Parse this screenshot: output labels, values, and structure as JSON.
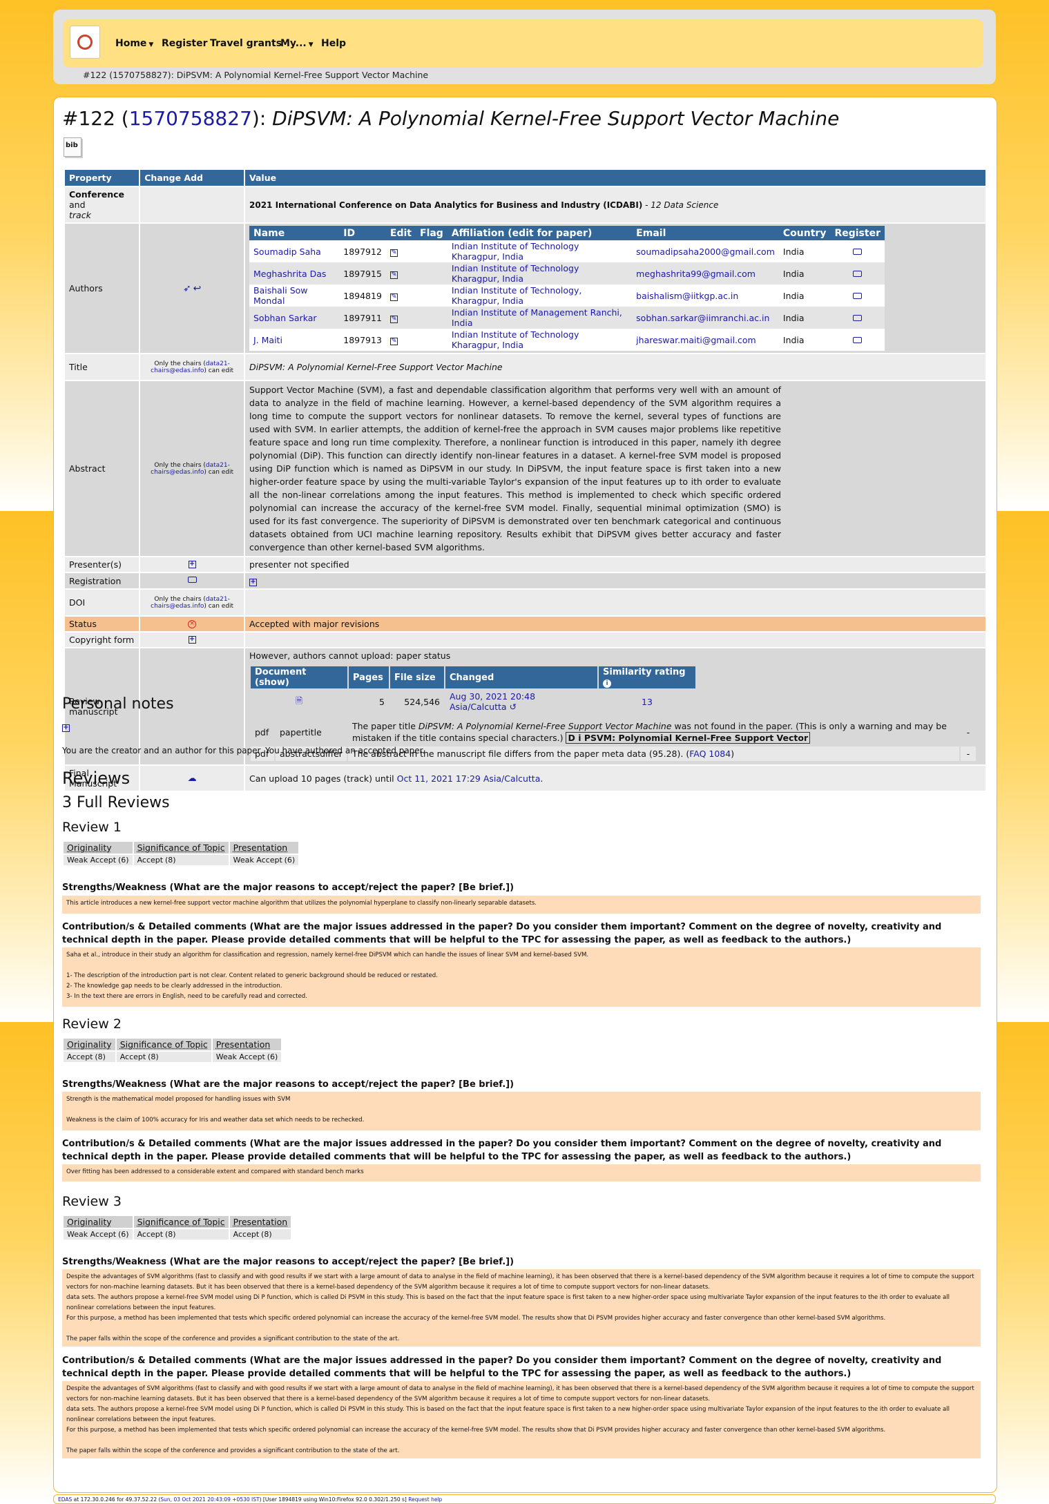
{
  "nav": {
    "items": [
      "Home",
      "Register",
      "Travel grants",
      "My...",
      "Help"
    ],
    "breadcrumb": "#122 (1570758827): DiPSVM: A Polynomial Kernel-Free Support Vector Machine"
  },
  "title": {
    "prefix": "#122 (",
    "id": "1570758827",
    "mid": "): ",
    "name": "DiPSVM: A Polynomial Kernel-Free Support Vector Machine"
  },
  "bib_label": "bib",
  "table": {
    "headers": [
      "Property",
      "Change Add",
      "Value"
    ],
    "conference_label_bold": "Conference",
    "conference_label_rest": " and",
    "conference_label_track": "track",
    "conference_value": "2021 International Conference on Data Analytics for Business and Industry (ICDABI)",
    "conference_track": " - 12 Data Science",
    "authors_label": "Authors",
    "author_headers": [
      "Name",
      "ID",
      "Edit",
      "Flag",
      "Affiliation (edit for paper)",
      "Email",
      "Country",
      "Register"
    ],
    "authors": [
      {
        "name": "Soumadip Saha",
        "id": "1897912",
        "aff": "Indian Institute of Technology Kharagpur, India",
        "email": "soumadipsaha2000@gmail.com",
        "country": "India"
      },
      {
        "name": "Meghashrita Das",
        "id": "1897915",
        "aff": "Indian Institute of Technology Kharagpur, India",
        "email": "meghashrita99@gmail.com",
        "country": "India"
      },
      {
        "name": "Baishali Sow Mondal",
        "id": "1894819",
        "aff": "Indian Institute of Technology, Kharagpur, India",
        "email": "baishalism@iitkgp.ac.in",
        "country": "India"
      },
      {
        "name": "Sobhan Sarkar",
        "id": "1897911",
        "aff": "Indian Institute of Management Ranchi, India",
        "email": "sobhan.sarkar@iimranchi.ac.in",
        "country": "India"
      },
      {
        "name": "J. Maiti",
        "id": "1897913",
        "aff": "Indian Institute of Technology Kharagpur, India",
        "email": "jhareswar.maiti@gmail.com",
        "country": "India"
      }
    ],
    "title_label": "Title",
    "only_chairs_pre": "Only the chairs (",
    "chairs_email": "data21-chairs@edas.info",
    "only_chairs_post": ") can edit",
    "title_value": "DiPSVM: A Polynomial Kernel-Free Support Vector Machine",
    "abstract_label": "Abstract",
    "abstract_value": "Support Vector Machine (SVM), a fast and dependable classification algorithm that performs very well with an amount of data to analyze in the field of machine learning. However, a kernel-based dependency of the SVM algorithm requires a long time to compute the support vectors for nonlinear datasets. To remove the kernel, several types of functions are used with SVM. In earlier attempts, the addition of kernel-free the approach in SVM causes major problems like repetitive feature space and long run time complexity. Therefore, a nonlinear function is introduced in this paper, namely ith degree polynomial (DiP). This function can directly identify non-linear features in a dataset. A kernel-free SVM model is proposed using DiP function which is named as DiPSVM in our study. In DiPSVM, the input feature space is first taken into a new higher-order feature space by using the multi-variable Taylor's expansion of the input features up to ith order to evaluate all the non-linear correlations among the input features. This method is implemented to check which specific ordered polynomial can increase the accuracy of the kernel-free SVM model. Finally, sequential minimal optimization (SMO) is used for its fast convergence. The superiority of DiPSVM is demonstrated over ten benchmark categorical and continuous datasets obtained from UCI machine learning repository. Results exhibit that DiPSVM gives better accuracy and faster convergence than other kernel-based SVM algorithms.",
    "presenter_label": "Presenter(s)",
    "presenter_value": "presenter not specified",
    "registration_label": "Registration",
    "doi_label": "DOI",
    "status_label": "Status",
    "status_value": "Accepted with major revisions",
    "copyright_label": "Copyright form",
    "review_ms_label": "Review manuscript",
    "review_ms_note": "However, authors cannot upload: paper status",
    "doc_headers": [
      "Document (show)",
      "Pages",
      "File size",
      "Changed",
      "Similarity rating"
    ],
    "doc_row": {
      "pages": "5",
      "size": "524,546",
      "changed": "Aug 30, 2021 20:48 Asia/Calcutta",
      "similarity": "13"
    },
    "warn1": {
      "type": "pdf",
      "code": "papertitle",
      "text_pre": "The paper title ",
      "text_title": "DiPSVM: A Polynomial Kernel-Free Support Vector Machine",
      "text_post": " was not found in the paper. (This is only a warning and may be mistaken if the title contains special characters.) ",
      "boxed": "D i PSVM: Polynomial Kernel-Free Support Vector",
      "dash": "-"
    },
    "warn2": {
      "type": "pdf",
      "code": "abstractsdiffer",
      "text": "The abstract in the manuscript file differs from the paper meta data (95.28). (",
      "faq": "FAQ 1084",
      "close": ")",
      "dash": "-"
    },
    "final_label": "Final Manuscript",
    "final_pre": "Can upload 10 pages (track) until ",
    "final_date": "Oct 11, 2021 17:29 Asia/Calcutta",
    "final_post": "."
  },
  "personal_notes": "Personal notes",
  "creator_note": "You are the creator and an author for this paper. You have authored an accepted paper.",
  "reviews_heading": "Reviews",
  "full_reviews": "3 Full Reviews",
  "score_headers": [
    "Originality",
    "Significance of Topic",
    "Presentation"
  ],
  "q1": "Strengths/Weakness (What are the major reasons to accept/reject the paper? [Be brief.])",
  "q2": "Contribution/s & Detailed comments (What are the major issues addressed in the paper? Do you consider them important? Comment on the degree of novelty, creativity and technical depth in the paper. Please provide detailed comments that will be helpful to the TPC for assessing the paper, as well as feedback to the authors.)",
  "reviews": [
    {
      "title": "Review 1",
      "scores": [
        [
          "Weak Accept",
          "(6)"
        ],
        [
          "Accept",
          "(8)"
        ],
        [
          "Weak Accept",
          "(6)"
        ]
      ],
      "a1": [
        "This article introduces a new kernel-free support vector machine algorithm that utilizes the polynomial hyperplane to classify non-linearly separable datasets."
      ],
      "a2": [
        "Saha et al., introduce in their study an algorithm for classification and regression, namely kernel-free DiPSVM which can handle the issues of linear SVM and kernel-based SVM.",
        "",
        "1- The description of the introduction part is not clear. Content related to generic background should be reduced or restated.",
        "2- The knowledge gap needs to be clearly addressed in the introduction.",
        "3- In the text there are errors in English, need to be carefully read and corrected."
      ]
    },
    {
      "title": "Review 2",
      "scores": [
        [
          "Accept",
          "(8)"
        ],
        [
          "Accept",
          "(8)"
        ],
        [
          "Weak Accept",
          "(6)"
        ]
      ],
      "a1": [
        "Strength is the mathematical model proposed for handling issues with SVM",
        "",
        "Weakness is the claim of 100% accuracy for Iris and weather data set which needs to be rechecked."
      ],
      "a2": [
        "Over fitting has been addressed to a considerable extent and compared with  standard bench marks"
      ]
    },
    {
      "title": "Review 3",
      "scores": [
        [
          "Weak Accept",
          "(6)"
        ],
        [
          "Accept",
          "(8)"
        ],
        [
          "Accept",
          "(8)"
        ]
      ],
      "a1": [
        "Despite the advantages of SVM algorithms (fast to classify and with good results if we start with a large amount of data to analyse in the field of machine learning), it has been observed that there is a kernel-based dependency of the SVM algorithm because it requires a lot of time to compute the support vectors for non-machine learning datasets. But it has been observed that there is a kernel-based dependency of the SVM algorithm because it requires a lot of time to compute support vectors for non-linear datasets.",
        "data sets. The authors propose a kernel-free SVM model using Di P function, which is called Di PSVM in this study. This is based on the fact that the input feature space is first taken to a new higher-order space using multivariate Taylor expansion of the input features to the ith order to evaluate all nonlinear correlations between the input features.",
        "For this purpose, a method has been implemented that tests which specific ordered polynomial can increase the accuracy of the kernel-free SVM model. The results show that Di PSVM provides higher accuracy and faster convergence than other kernel-based SVM algorithms.",
        "",
        "The paper falls within the scope of the conference and provides a significant contribution to the state of the art."
      ],
      "a2": [
        "Despite the advantages of SVM algorithms (fast to classify and with good results if we start with a large amount of data to analyse in the field of machine learning), it has been observed that there is a kernel-based dependency of the SVM algorithm because it requires a lot of time to compute the support vectors for non-machine learning datasets. But it has been observed that there is a kernel-based dependency of the SVM algorithm because it requires a lot of time to compute support vectors for non-linear datasets.",
        "data sets. The authors propose a kernel-free SVM model using Di P function, which is called Di PSVM in this study. This is based on the fact that the input feature space is first taken to a new higher-order space using multivariate Taylor expansion of the input features to the ith order to evaluate all nonlinear correlations between the input features.",
        "For this purpose, a method has been implemented that tests which specific ordered polynomial can increase the accuracy of the kernel-free SVM model. The results show that Di PSVM provides higher accuracy and faster convergence than other kernel-based SVM algorithms.",
        "",
        "The paper falls within the scope of the conference and provides a significant contribution to the state of the art."
      ]
    }
  ],
  "footer": {
    "pre": "EDAS",
    "mid": " at 172.30.0.246 for 49.37.52.22 (",
    "date": "Sun, 03 Oct 2021 20:43:09 +0530 IST",
    "rest": ") [User 1894819 using Win10:Firefox 92.0 0.302/1.250 s] ",
    "help": "Request help"
  }
}
